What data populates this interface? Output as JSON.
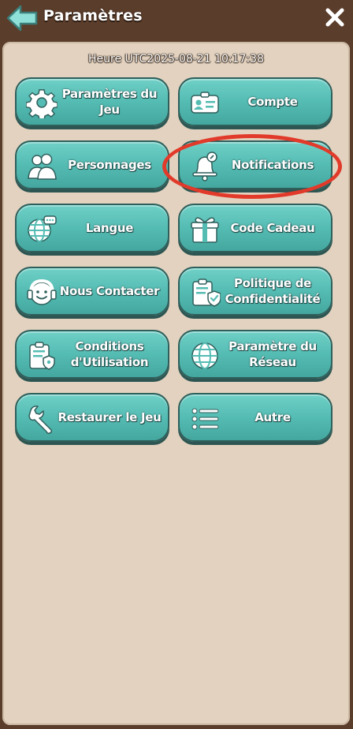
{
  "header": {
    "title": "Paramètres"
  },
  "status": {
    "utc_time": "Heure UTC2025-08-21 10:17:38"
  },
  "buttons": {
    "game_settings": "Paramètres du Jeu",
    "account": "Compte",
    "characters": "Personnages",
    "notifications": "Notifications",
    "language": "Langue",
    "gift_code": "Code Cadeau",
    "contact": "Nous Contacter",
    "privacy": "Politique de Confidentialité",
    "terms": "Conditions d'Utilisation",
    "network": "Paramètre du Réseau",
    "restore": "Restaurer le Jeu",
    "other": "Autre"
  },
  "icons": {
    "back": "arrow-left-icon",
    "close": "close-icon",
    "game_settings": "gear-icon",
    "account": "id-card-icon",
    "characters": "users-icon",
    "notifications": "bell-icon",
    "language": "globe-chat-icon",
    "gift_code": "gift-icon",
    "contact": "headset-icon",
    "privacy": "clipboard-shield-icon",
    "terms": "clipboard-shield-icon",
    "network": "globe-icon",
    "restore": "wrench-icon",
    "other": "list-icon"
  },
  "colors": {
    "button_teal": "#55bcb3",
    "panel_beige": "#e2d2bf",
    "frame_brown": "#5b3d2b",
    "highlight_red": "#e23a2a"
  }
}
